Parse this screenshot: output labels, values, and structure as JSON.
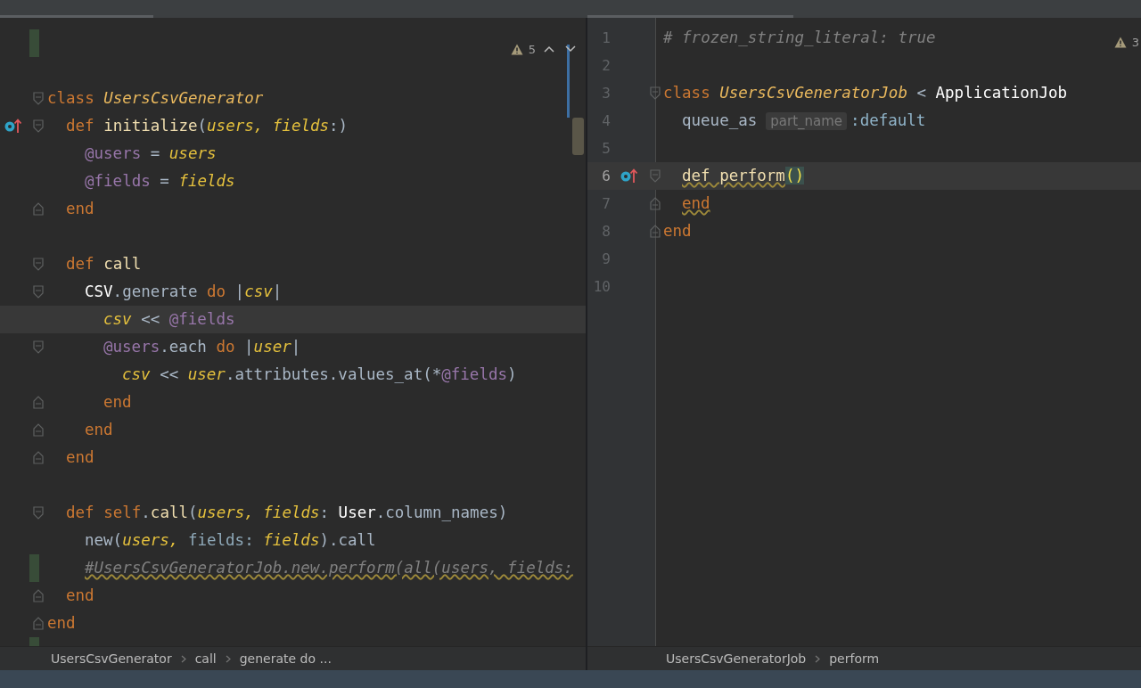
{
  "left_editor": {
    "problems": "5",
    "lines": [
      {
        "fold_start": false,
        "fold_end": false,
        "override_marker": false,
        "changed": true,
        "current": false
      },
      {
        "fold_start": false,
        "fold_end": false,
        "override_marker": false,
        "changed": false,
        "current": false
      },
      {
        "tokens": [
          {
            "text": "class ",
            "kind": "keyword"
          },
          {
            "text": "UsersCsvGenerator",
            "kind": "class"
          }
        ],
        "fold_start": true,
        "fold_end": false,
        "override_marker": false,
        "changed": false,
        "current": false,
        "children": [
          {
            "tokens": [
              {
                "text": "def ",
                "kind": "keyword"
              },
              {
                "text": "initialize",
                "kind": "method"
              },
              {
                "text": "(",
                "kind": "plain"
              },
              {
                "text": "users, fields",
                "kind": "param"
              },
              {
                "text": ":)",
                "kind": "plain"
              }
            ],
            "fold_start": true,
            "fold_end": false,
            "override_marker": true,
            "changed": false,
            "current": false,
            "children": [
              {
                "tokens": [
                  {
                    "text": "@users",
                    "kind": "ivar"
                  },
                  {
                    "text": " = ",
                    "kind": "plain"
                  },
                  {
                    "text": "users",
                    "kind": "param"
                  }
                ],
                "fold_start": false,
                "fold_end": false,
                "override_marker": false,
                "changed": false,
                "current": false
              },
              {
                "tokens": [
                  {
                    "text": "@fields",
                    "kind": "ivar"
                  },
                  {
                    "text": " = ",
                    "kind": "plain"
                  },
                  {
                    "text": "fields",
                    "kind": "param"
                  }
                ],
                "fold_start": false,
                "fold_end": false,
                "override_marker": false,
                "changed": false,
                "current": false
              }
            ]
          },
          {
            "tokens": [
              {
                "text": "end",
                "kind": "keyword"
              }
            ],
            "fold_start": false,
            "fold_end": true,
            "override_marker": false,
            "changed": false,
            "current": false
          },
          {
            "fold_start": false,
            "fold_end": false,
            "override_marker": false,
            "changed": false,
            "current": false
          },
          {
            "tokens": [
              {
                "text": "def ",
                "kind": "keyword"
              },
              {
                "text": "call",
                "kind": "method"
              }
            ],
            "fold_start": true,
            "fold_end": false,
            "override_marker": false,
            "changed": false,
            "current": false,
            "children": [
              {
                "tokens": [
                  {
                    "text": "CSV",
                    "kind": "constant"
                  },
                  {
                    "text": ".generate ",
                    "kind": "plain"
                  },
                  {
                    "text": "do",
                    "kind": "keyword"
                  },
                  {
                    "text": " |",
                    "kind": "plain"
                  },
                  {
                    "text": "csv",
                    "kind": "param"
                  },
                  {
                    "text": "|",
                    "kind": "plain"
                  }
                ],
                "fold_start": true,
                "fold_end": false,
                "override_marker": false,
                "changed": false,
                "current": false,
                "children": [
                  {
                    "tokens": [
                      {
                        "text": "csv",
                        "kind": "param"
                      },
                      {
                        "text": " << ",
                        "kind": "plain"
                      },
                      {
                        "text": "@fields",
                        "kind": "ivar"
                      }
                    ],
                    "fold_start": false,
                    "fold_end": false,
                    "override_marker": false,
                    "changed": false,
                    "current": true
                  },
                  {
                    "tokens": [
                      {
                        "text": "@users",
                        "kind": "ivar"
                      },
                      {
                        "text": ".each ",
                        "kind": "plain"
                      },
                      {
                        "text": "do",
                        "kind": "keyword"
                      },
                      {
                        "text": " |",
                        "kind": "plain"
                      },
                      {
                        "text": "user",
                        "kind": "param"
                      },
                      {
                        "text": "|",
                        "kind": "plain"
                      }
                    ],
                    "fold_start": true,
                    "fold_end": false,
                    "override_marker": false,
                    "changed": false,
                    "current": false,
                    "children": [
                      {
                        "tokens": [
                          {
                            "text": "csv",
                            "kind": "param"
                          },
                          {
                            "text": " << ",
                            "kind": "plain"
                          },
                          {
                            "text": "user",
                            "kind": "param"
                          },
                          {
                            "text": ".attributes.values_at(*",
                            "kind": "plain"
                          },
                          {
                            "text": "@fields",
                            "kind": "ivar"
                          },
                          {
                            "text": ")",
                            "kind": "plain"
                          }
                        ],
                        "fold_start": false,
                        "fold_end": false,
                        "override_marker": false,
                        "changed": false,
                        "current": false
                      }
                    ]
                  },
                  {
                    "tokens": [
                      {
                        "text": "end",
                        "kind": "keyword"
                      }
                    ],
                    "fold_start": false,
                    "fold_end": true,
                    "override_marker": false,
                    "changed": false,
                    "current": false
                  }
                ]
              },
              {
                "tokens": [
                  {
                    "text": "end",
                    "kind": "keyword"
                  }
                ],
                "fold_start": false,
                "fold_end": true,
                "override_marker": false,
                "changed": false,
                "current": false
              }
            ]
          },
          {
            "tokens": [
              {
                "text": "end",
                "kind": "keyword"
              }
            ],
            "fold_start": false,
            "fold_end": true,
            "override_marker": false,
            "changed": false,
            "current": false
          },
          {
            "fold_start": false,
            "fold_end": false,
            "override_marker": false,
            "changed": false,
            "current": false
          },
          {
            "tokens": [
              {
                "text": "def ",
                "kind": "keyword"
              },
              {
                "text": "self",
                "kind": "keyword"
              },
              {
                "text": ".",
                "kind": "plain"
              },
              {
                "text": "call",
                "kind": "method"
              },
              {
                "text": "(",
                "kind": "plain"
              },
              {
                "text": "users, fields",
                "kind": "param"
              },
              {
                "text": ": ",
                "kind": "plain"
              },
              {
                "text": "User",
                "kind": "constant"
              },
              {
                "text": ".column_names)",
                "kind": "plain"
              }
            ],
            "fold_start": true,
            "fold_end": false,
            "override_marker": false,
            "changed": false,
            "current": false,
            "children": [
              {
                "tokens": [
                  {
                    "text": "new(",
                    "kind": "plain"
                  },
                  {
                    "text": "users, ",
                    "kind": "param"
                  },
                  {
                    "text": "fields: ",
                    "kind": "label"
                  },
                  {
                    "text": "fields",
                    "kind": "param"
                  },
                  {
                    "text": ").call",
                    "kind": "plain"
                  }
                ],
                "fold_start": false,
                "fold_end": false,
                "override_marker": false,
                "changed": false,
                "current": false
              },
              {
                "tokens": [
                  {
                    "text": "#UsersCsvGeneratorJob.new.perform(all(users, fields:",
                    "kind": "comment",
                    "warn": true
                  }
                ],
                "fold_start": false,
                "fold_end": false,
                "override_marker": false,
                "changed": true,
                "current": false
              }
            ]
          },
          {
            "tokens": [
              {
                "text": "end",
                "kind": "keyword"
              }
            ],
            "fold_start": false,
            "fold_end": true,
            "override_marker": false,
            "changed": false,
            "current": false
          }
        ]
      },
      {
        "tokens": [
          {
            "text": "end",
            "kind": "keyword"
          }
        ],
        "fold_start": false,
        "fold_end": true,
        "override_marker": false,
        "changed": false,
        "current": false
      },
      {
        "fold_start": false,
        "fold_end": false,
        "override_marker": false,
        "changed": true,
        "current": false
      }
    ],
    "breadcrumbs": [
      "UsersCsvGenerator",
      "call",
      "generate do ..."
    ]
  },
  "right_editor": {
    "problems": "3",
    "lines": [
      {
        "number": "1",
        "tokens": [
          {
            "text": "# frozen_string_literal: true",
            "kind": "comment"
          }
        ],
        "fold_start": false,
        "fold_end": false,
        "override_marker": false,
        "current": false
      },
      {
        "number": "2",
        "fold_start": false,
        "fold_end": false,
        "override_marker": false,
        "current": false
      },
      {
        "number": "3",
        "tokens": [
          {
            "text": "class ",
            "kind": "keyword"
          },
          {
            "text": "UsersCsvGeneratorJob",
            "kind": "class"
          },
          {
            "text": " < ",
            "kind": "plain"
          },
          {
            "text": "ApplicationJob",
            "kind": "constant"
          }
        ],
        "fold_start": true,
        "fold_end": false,
        "override_marker": false,
        "current": false,
        "children": [
          {
            "number": "4",
            "tokens": [
              {
                "text": "queue_as",
                "kind": "plain"
              },
              {
                "text": "part_name",
                "kind": "hint"
              },
              {
                "text": ":default",
                "kind": "symbol"
              }
            ],
            "fold_start": false,
            "fold_end": false,
            "override_marker": false,
            "current": false
          },
          {
            "number": "5",
            "fold_start": false,
            "fold_end": false,
            "override_marker": false,
            "current": false
          },
          {
            "number": "6",
            "tokens": [
              {
                "text": "def perform",
                "kind": "method",
                "warn": true
              },
              {
                "text": "()",
                "kind": "brace"
              }
            ],
            "fold_start": true,
            "fold_end": false,
            "override_marker": true,
            "current": true
          },
          {
            "number": "7",
            "tokens": [
              {
                "text": "end",
                "kind": "keyword",
                "warn": true
              }
            ],
            "fold_start": false,
            "fold_end": true,
            "override_marker": false,
            "current": false
          }
        ]
      },
      {
        "number": "8",
        "tokens": [
          {
            "text": "end",
            "kind": "keyword"
          }
        ],
        "fold_start": false,
        "fold_end": true,
        "override_marker": false,
        "current": false
      },
      {
        "number": "9",
        "fold_start": false,
        "fold_end": false,
        "override_marker": false,
        "current": false
      },
      {
        "number": "10",
        "fold_start": false,
        "fold_end": false,
        "override_marker": false,
        "current": false
      }
    ],
    "breadcrumbs": [
      "UsersCsvGeneratorJob",
      "perform"
    ]
  }
}
